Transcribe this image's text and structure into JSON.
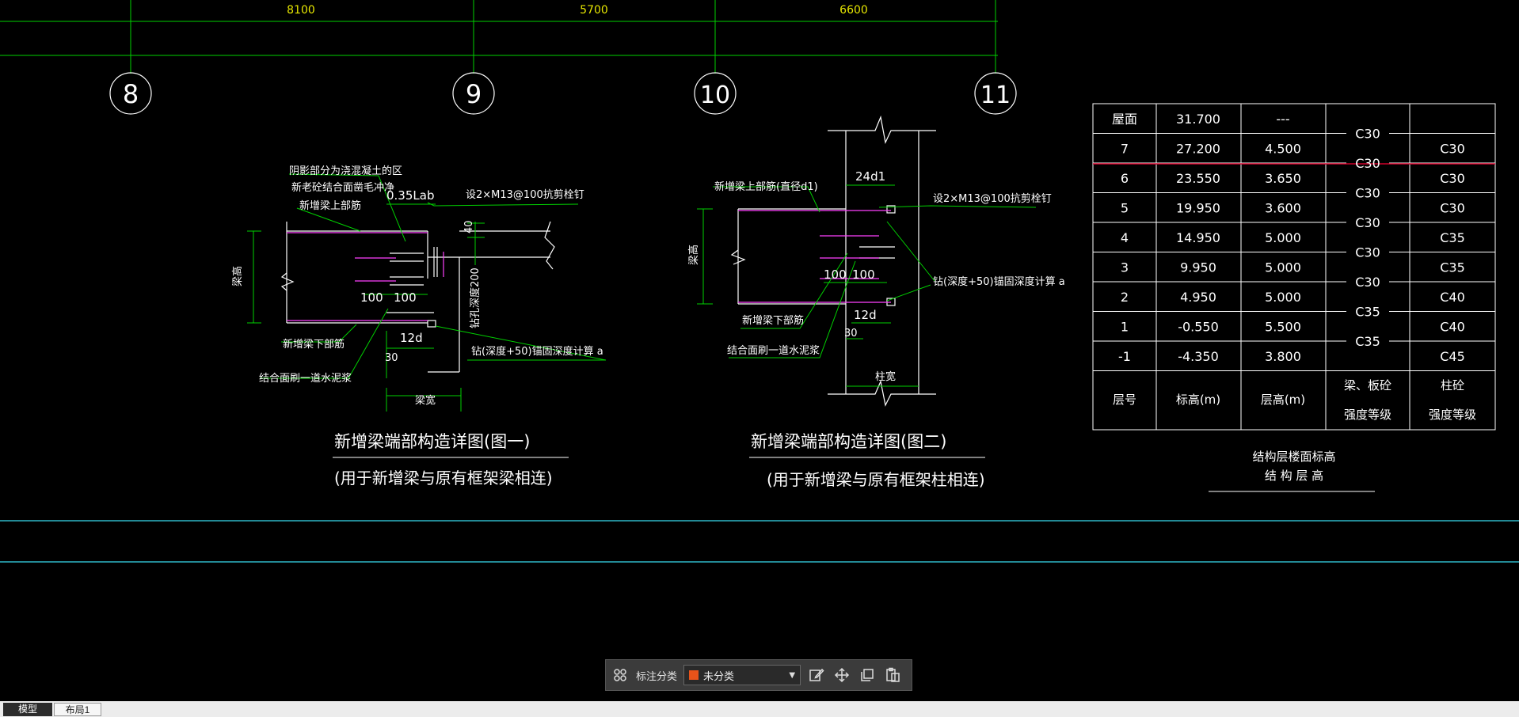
{
  "dimensions": [
    "8100",
    "5700",
    "6600"
  ],
  "axes": [
    "8",
    "9",
    "10",
    "11"
  ],
  "detail1": {
    "title": "新增梁端部构造详图(图一)",
    "subtitle": "(用于新增梁与原有框架梁相连)",
    "notes": {
      "shade": "阴影部分为浇混凝土的区",
      "shade2": "新老砼结合面凿毛冲净",
      "top_bar": "新增梁上部筋",
      "bot_bar": "新增梁下部筋",
      "grout": "结合面刷一道水泥浆",
      "studs": "设2×M13@100抗剪栓钉",
      "drill": "钻(深度+50)锚固深度计算 a",
      "side": "梁高",
      "depth": "钻孔深度200",
      "width": "梁宽"
    },
    "dims": {
      "lab": "0.35Lab",
      "d40": "40",
      "d100a": "100",
      "d100b": "100",
      "d12": "12d",
      "d30": "30"
    }
  },
  "detail2": {
    "title": "新增梁端部构造详图(图二)",
    "subtitle": "(用于新增梁与原有框架柱相连)",
    "notes": {
      "top_bar": "新增梁上部筋(直径d1)",
      "bot_bar": "新增梁下部筋",
      "grout": "结合面刷一道水泥浆",
      "studs": "设2×M13@100抗剪栓钉",
      "drill": "钻(深度+50)锚固深度计算 a",
      "side": "梁高",
      "width": "柱宽"
    },
    "dims": {
      "d24": "24d1",
      "d100a": "100",
      "d100b": "100",
      "d12": "12d",
      "d30": "30"
    }
  },
  "table": {
    "rows": [
      {
        "floor": "屋面",
        "elev": "31.700",
        "height": "---",
        "col": ""
      },
      {
        "floor": "7",
        "elev": "27.200",
        "height": "4.500",
        "col": "C30"
      },
      {
        "floor": "6",
        "elev": "23.550",
        "height": "3.650",
        "col": "C30"
      },
      {
        "floor": "5",
        "elev": "19.950",
        "height": "3.600",
        "col": "C30"
      },
      {
        "floor": "4",
        "elev": "14.950",
        "height": "5.000",
        "col": "C35"
      },
      {
        "floor": "3",
        "elev": "9.950",
        "height": "5.000",
        "col": "C35"
      },
      {
        "floor": "2",
        "elev": "4.950",
        "height": "5.000",
        "col": "C40"
      },
      {
        "floor": "1",
        "elev": "-0.550",
        "height": "5.500",
        "col": "C40"
      },
      {
        "floor": "-1",
        "elev": "-4.350",
        "height": "3.800",
        "col": "C45"
      }
    ],
    "beam_grades": [
      "C30",
      "C30",
      "C30",
      "C30",
      "C30",
      "C30",
      "C35",
      "C35"
    ],
    "header": {
      "floor": "层号",
      "elev": "标高(m)",
      "height": "层高(m)",
      "beam_1": "梁、板砼",
      "beam_2": "强度等级",
      "col_1": "柱砼",
      "col_2": "强度等级"
    },
    "caption_1": "结构层楼面标高",
    "caption_2": "结 构 层 高"
  },
  "toolbar": {
    "label": "标注分类",
    "selected": "未分类",
    "swatch_color": "#e8531a"
  },
  "tabs": [
    "模型",
    "布局1"
  ]
}
